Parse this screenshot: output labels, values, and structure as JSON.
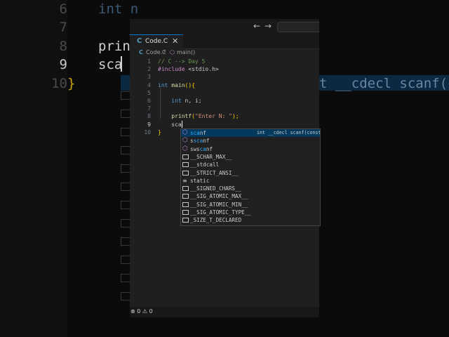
{
  "background": {
    "line_numbers": [
      "6",
      "7",
      "8",
      "9",
      "10"
    ],
    "code_lines": [
      "int n",
      "",
      "print",
      "sca",
      "}"
    ],
    "suggestion_detail": "t __cdecl scanf(const"
  },
  "titlebar": {
    "back_icon": "←",
    "forward_icon": "→"
  },
  "tab": {
    "icon": "C",
    "name": "Code.C",
    "close_icon": "✕"
  },
  "breadcrumb": {
    "file_icon": "C",
    "file": "Code.C",
    "separator": "›",
    "symbol_icon": "⬡",
    "symbol": "main()"
  },
  "editor": {
    "line_numbers": [
      "1",
      "2",
      "3",
      "4",
      "5",
      "6",
      "7",
      "8",
      "9",
      "10"
    ],
    "active_line": "9",
    "lines": {
      "l1": "// C --> Day 5",
      "l2_directive": "#include",
      "l2_header": " <stdio.h>",
      "l4_type": "int",
      "l4_name": " main",
      "l4_paren": "()",
      "l4_brace": "{",
      "l6_type": "int",
      "l6_rest": " n, i;",
      "l8_fn": "printf",
      "l8_open": "(",
      "l8_str": "\"Enter N: \"",
      "l8_close": ");",
      "l9": "sca",
      "l10": "}"
    }
  },
  "suggestions": [
    {
      "icon": "cube",
      "match": "sca",
      "rest": "nf",
      "detail": "int __cdecl scanf(const",
      "selected": true
    },
    {
      "icon": "cube",
      "pre": "s",
      "match": "sca",
      "rest": "nf",
      "detail": ""
    },
    {
      "icon": "cube",
      "pre": "sws",
      "match": "ca",
      "rest": "nf",
      "detail": ""
    },
    {
      "icon": "box",
      "label": "__SCHAR_MAX__",
      "detail": ""
    },
    {
      "icon": "box",
      "label": "__stdcall",
      "detail": ""
    },
    {
      "icon": "box",
      "label": "__STRICT_ANSI__",
      "detail": ""
    },
    {
      "icon": "keyword",
      "label": "static",
      "detail": ""
    },
    {
      "icon": "box",
      "label": "__SIGNED_CHARS__",
      "detail": ""
    },
    {
      "icon": "box",
      "label": "__SIG_ATOMIC_MAX__",
      "detail": ""
    },
    {
      "icon": "box",
      "label": "__SIG_ATOMIC_MIN__",
      "detail": ""
    },
    {
      "icon": "box",
      "label": "__SIG_ATOMIC_TYPE__",
      "detail": ""
    },
    {
      "icon": "box",
      "label": "_SIZE_T_DECLARED",
      "detail": ""
    }
  ],
  "status": {
    "problems": "⊗ 0 ⚠ 0"
  },
  "colors": {
    "accent": "#0078d4",
    "selection": "#04395e",
    "match_highlight": "#2aaaff"
  }
}
